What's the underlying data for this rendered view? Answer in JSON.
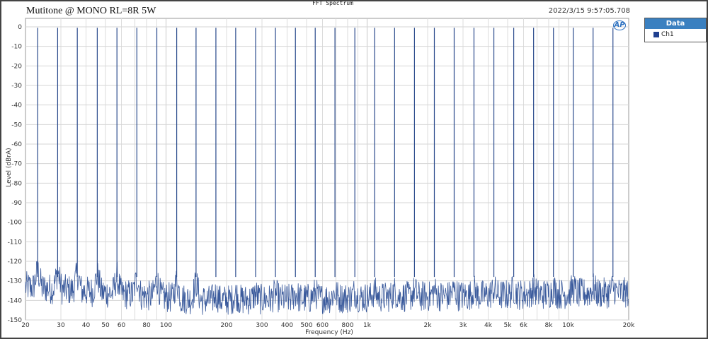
{
  "chart_data": {
    "type": "line",
    "title": "FFT Spectrum",
    "subtitle": "Mutitone @ MONO RL=8R 5W",
    "timestamp": "2022/3/15 9:57:05.708",
    "xlabel": "Frequency (Hz)",
    "ylabel": "Level (dBrA)",
    "xscale": "log",
    "xlim": [
      20,
      20000
    ],
    "ylim": [
      -150,
      0
    ],
    "grid": true,
    "legend_placement": "right-outside",
    "legend_title": "Data",
    "x_ticks": [
      20,
      30,
      40,
      50,
      60,
      80,
      100,
      200,
      300,
      400,
      500,
      600,
      800,
      1000,
      2000,
      3000,
      4000,
      5000,
      6000,
      8000,
      10000,
      20000
    ],
    "x_tick_labels": [
      "20",
      "30",
      "40",
      "50",
      "60",
      "80",
      "100",
      "200",
      "300",
      "400",
      "500",
      "600",
      "800",
      "1k",
      "2k",
      "3k",
      "4k",
      "5k",
      "6k",
      "8k",
      "10k",
      "20k"
    ],
    "y_ticks": [
      0,
      -10,
      -20,
      -30,
      -40,
      -50,
      -60,
      -70,
      -80,
      -90,
      -100,
      -110,
      -120,
      -130,
      -140,
      -150
    ],
    "series": [
      {
        "name": "Ch1",
        "color": "#3a5a9c",
        "tone_frequencies_hz": [
          23,
          28.9,
          36.2,
          45.5,
          57,
          71.6,
          90,
          113,
          141,
          177,
          222,
          279,
          350,
          440,
          552,
          692,
          869,
          1090,
          1370,
          1720,
          2160,
          2710,
          3400,
          4270,
          5360,
          6730,
          8450,
          10600,
          13300,
          16700
        ],
        "tone_level_db": -0.5,
        "noise_floor_db": {
          "low_freq_mean": -133,
          "mid_freq_mean": -140,
          "high_freq_mean": -136,
          "min": -150
        }
      }
    ]
  },
  "logo": "AP"
}
